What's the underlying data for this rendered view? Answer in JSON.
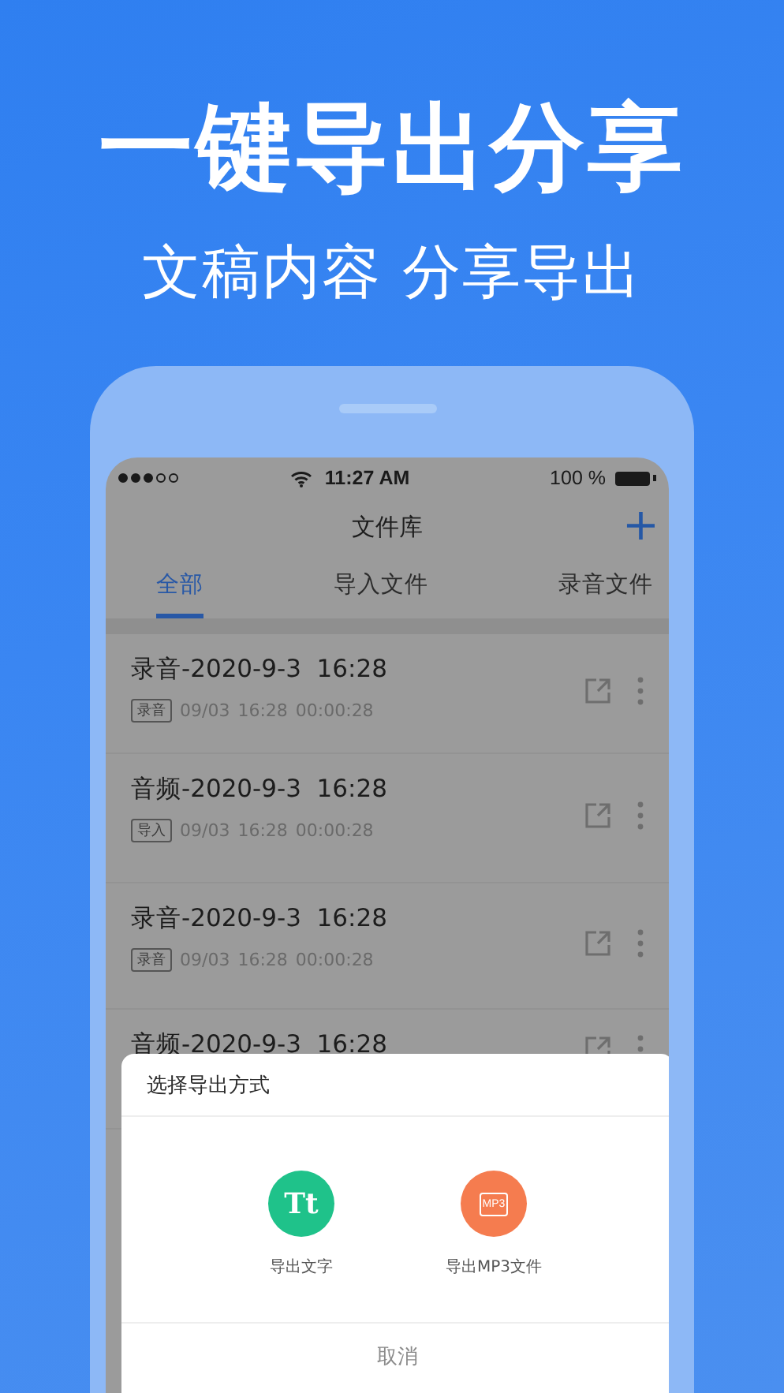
{
  "headline": "一键导出分享",
  "subheadline": "文稿内容 分享导出",
  "status_bar": {
    "time": "11:27 AM",
    "battery": "100 %"
  },
  "nav": {
    "title": "文件库",
    "add": "+"
  },
  "tabs": [
    {
      "label": "全部",
      "selected": true
    },
    {
      "label": "导入文件",
      "selected": false
    },
    {
      "label": "录音文件",
      "selected": false
    }
  ],
  "files": [
    {
      "title": "录音-2020-9-3  16:28",
      "tag": "录音",
      "date": "09/03",
      "time": "16:28",
      "duration": "00:00:28"
    },
    {
      "title": "音频-2020-9-3  16:28",
      "tag": "导入",
      "date": "09/03",
      "time": "16:28",
      "duration": "00:00:28"
    },
    {
      "title": "录音-2020-9-3  16:28",
      "tag": "录音",
      "date": "09/03",
      "time": "16:28",
      "duration": "00:00:28"
    },
    {
      "title": "音频-2020-9-3  16:28"
    }
  ],
  "sheet": {
    "title": "选择导出方式",
    "options": [
      {
        "kind": "text",
        "glyph": "Tt",
        "label": "导出文字",
        "color": "#1fc28a"
      },
      {
        "kind": "mp3",
        "glyph": "MP3",
        "label": "导出MP3文件",
        "color": "#f57c4f"
      }
    ],
    "cancel": "取消"
  }
}
